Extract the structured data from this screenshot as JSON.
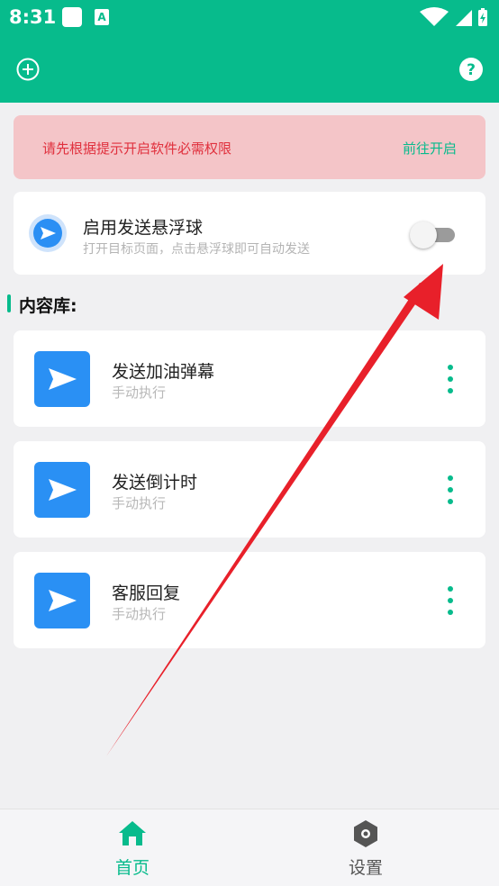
{
  "status_bar": {
    "time": "8:31",
    "app_icon_letter": "A"
  },
  "app_bar": {
    "add_icon": "plus-circle-icon",
    "help_icon": "question-circle-icon"
  },
  "permission_banner": {
    "message": "请先根据提示开启软件必需权限",
    "action_label": "前往开启"
  },
  "floating_ball": {
    "title": "启用发送悬浮球",
    "subtitle": "打开目标页面，点击悬浮球即可自动发送",
    "enabled": false
  },
  "library": {
    "heading": "内容库:",
    "items": [
      {
        "name": "发送加油弹幕",
        "mode": "手动执行"
      },
      {
        "name": "发送倒计时",
        "mode": "手动执行"
      },
      {
        "name": "客服回复",
        "mode": "手动执行"
      }
    ]
  },
  "bottom_nav": {
    "items": [
      {
        "label": "首页",
        "icon": "home-icon",
        "active": true
      },
      {
        "label": "设置",
        "icon": "settings-hexagon-icon",
        "active": false
      }
    ]
  },
  "colors": {
    "primary": "#07bb8c",
    "banner_bg": "#f4c5c8",
    "banner_text": "#e0303d",
    "icon_blue": "#2a90f4",
    "annotation_arrow": "#e8202a"
  }
}
